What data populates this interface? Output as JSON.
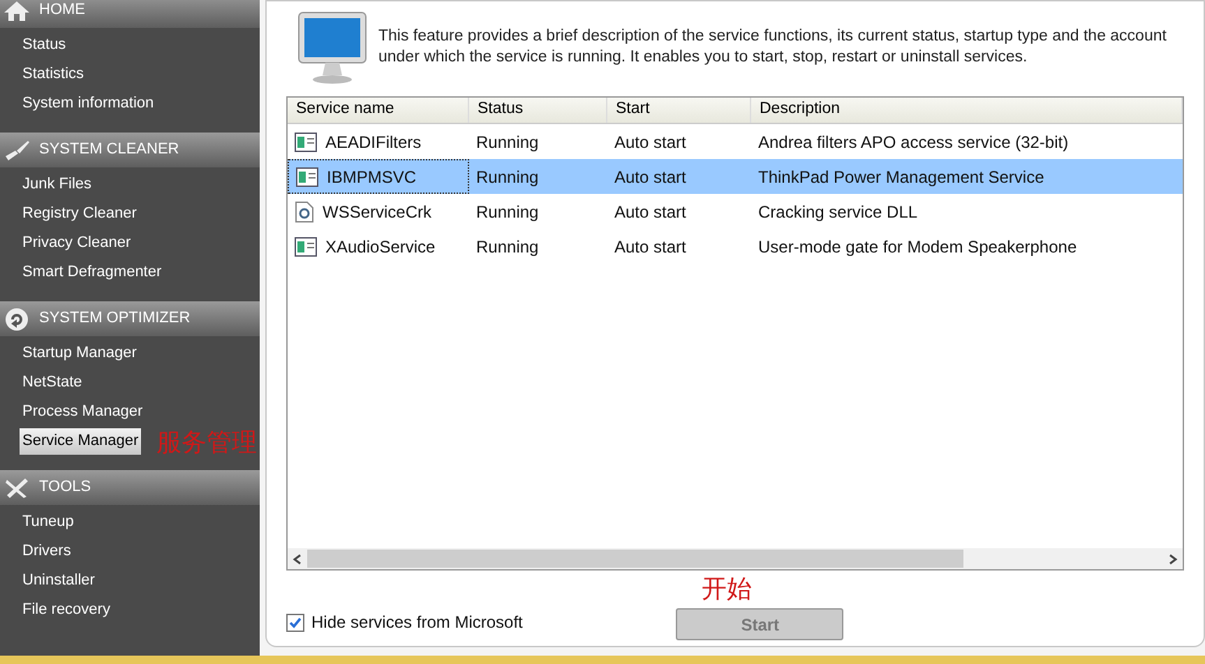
{
  "sidebar": {
    "sections": [
      {
        "title": "HOME",
        "kind": "home",
        "items": [
          {
            "label": "Status",
            "selected": false
          },
          {
            "label": "Statistics",
            "selected": false
          },
          {
            "label": "System information",
            "selected": false
          }
        ]
      },
      {
        "title": "SYSTEM CLEANER",
        "kind": "brush",
        "items": [
          {
            "label": "Junk Files",
            "selected": false
          },
          {
            "label": "Registry Cleaner",
            "selected": false
          },
          {
            "label": "Privacy Cleaner",
            "selected": false
          },
          {
            "label": "Smart Defragmenter",
            "selected": false
          }
        ]
      },
      {
        "title": "SYSTEM OPTIMIZER",
        "kind": "optimizer",
        "items": [
          {
            "label": "Startup Manager",
            "selected": false
          },
          {
            "label": "NetState",
            "selected": false
          },
          {
            "label": "Process Manager",
            "selected": false
          },
          {
            "label": "Service Manager",
            "selected": true,
            "annotation": "服务管理"
          }
        ]
      },
      {
        "title": "TOOLS",
        "kind": "tools",
        "items": [
          {
            "label": "Tuneup",
            "selected": false
          },
          {
            "label": "Drivers",
            "selected": false
          },
          {
            "label": "Uninstaller",
            "selected": false
          },
          {
            "label": "File recovery",
            "selected": false
          }
        ]
      }
    ]
  },
  "description": "This feature provides a brief description of the service functions, its current status, startup type and the account under which the service is running. It enables you to start, stop, restart or uninstall services.",
  "table": {
    "columns": [
      "Service name",
      "Status",
      "Start",
      "Description"
    ],
    "rows": [
      {
        "kind": "app",
        "cells": [
          "AEADIFilters",
          "Running",
          "Auto start",
          "Andrea filters APO access service (32-bit)"
        ],
        "selected": false
      },
      {
        "kind": "app",
        "cells": [
          "IBMPMSVC",
          "Running",
          "Auto start",
          "ThinkPad Power Management Service"
        ],
        "selected": true
      },
      {
        "kind": "dll",
        "cells": [
          "WSServiceCrk",
          "Running",
          "Auto start",
          "Cracking service DLL"
        ],
        "selected": false
      },
      {
        "kind": "app",
        "cells": [
          "XAudioService",
          "Running",
          "Auto start",
          "User-mode gate for Modem Speakerphone"
        ],
        "selected": false
      }
    ]
  },
  "hide_microsoft": {
    "label": "Hide services from Microsoft",
    "checked": true
  },
  "start_button": {
    "label": "Start",
    "disabled": true,
    "annotation": "开始"
  }
}
